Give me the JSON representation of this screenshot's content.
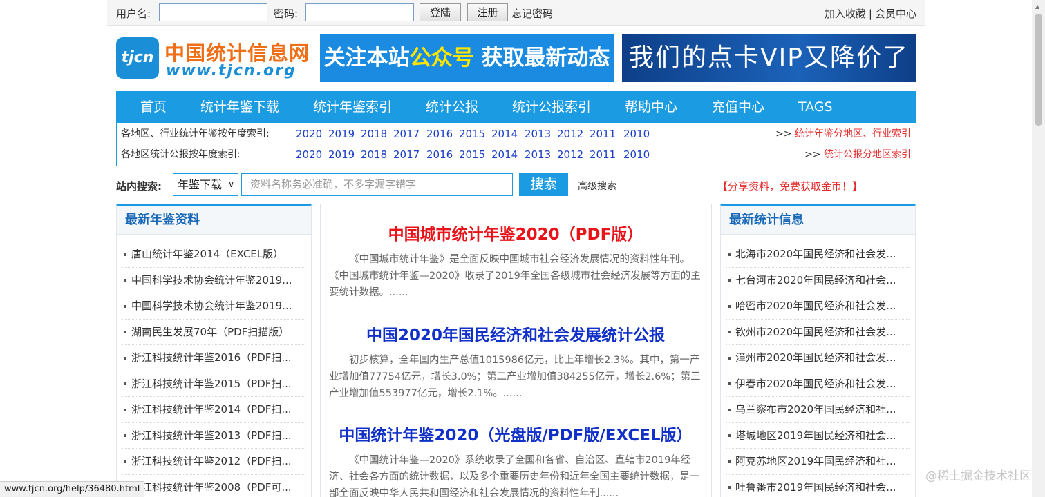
{
  "topbar": {
    "username_label": "用户名:",
    "password_label": "密码:",
    "login_button": "登陆",
    "register_button": "注册",
    "forgot_password": "忘记密码",
    "add_favorite": "加入收藏",
    "separator": "|",
    "member_center": "会员中心"
  },
  "header": {
    "logo_badge": "tjcn",
    "logo_cn": "中国统计信息网",
    "logo_en": "www.tjcn.org",
    "banner1_part1": "关注本站",
    "banner1_highlight": "公众号",
    "banner1_part2": " 获取最新动态",
    "banner2": "我们的点卡VIP又降价了"
  },
  "nav": {
    "items": [
      "首页",
      "统计年鉴下载",
      "统计年鉴索引",
      "统计公报",
      "统计公报索引",
      "帮助中心",
      "充值中心",
      "TAGS"
    ]
  },
  "year_index": {
    "row1_label": "各地区、行业统计年鉴按年度索引:",
    "row2_label": "各地区统计公报按年度索引:",
    "years": [
      "2020",
      "2019",
      "2018",
      "2017",
      "2016",
      "2015",
      "2014",
      "2013",
      "2012",
      "2011",
      "2010"
    ],
    "arrow": ">>",
    "row1_more": "统计年鉴分地区、行业索引",
    "row2_more": "统计公报分地区索引"
  },
  "search": {
    "label": "站内搜索:",
    "select_value": "年鉴下载",
    "placeholder": "资料名称务必准确，不多字漏字错字",
    "button": "搜索",
    "advanced": "高级搜索",
    "share_notice": "【分享资料，免费获取金币！】"
  },
  "left_panel": {
    "title": "最新年鉴资料",
    "items": [
      "唐山统计年鉴2014（EXCEL版）",
      "中国科学技术协会统计年鉴2019...",
      "中国科学技术协会统计年鉴2019...",
      "湖南民生发展70年（PDF扫描版）",
      "浙江科技统计年鉴2016（PDF扫...",
      "浙江科技统计年鉴2015（PDF扫...",
      "浙江科技统计年鉴2014（PDF扫...",
      "浙江科技统计年鉴2013（PDF扫...",
      "浙江科技统计年鉴2012（PDF扫...",
      "浙江科技统计年鉴2008（PDF可..."
    ]
  },
  "center": {
    "articles": [
      {
        "title": "中国城市统计年鉴2020（PDF版）",
        "color": "#e8141a",
        "summary": "《中国城市统计年鉴》是全面反映中国城市社会经济发展情况的资料性年刊。《中国城市统计年鉴—2020》收录了2019年全国各级城市社会经济发展等方面的主要统计数据。......"
      },
      {
        "title": "中国2020年国民经济和社会发展统计公报",
        "color": "#1030c8",
        "summary": "初步核算，全年国内生产总值1015986亿元，比上年增长2.3%。其中，第一产业增加值77754亿元，增长3.0%；第二产业增加值384255亿元，增长2.6%；第三产业增加值553977亿元，增长2.1%。......"
      },
      {
        "title": "中国统计年鉴2020（光盘版/PDF版/EXCEL版）",
        "color": "#1030c8",
        "summary": "《中国统计年鉴—2020》系统收录了全国和各省、自治区、直辖市2019年经济、社会各方面的统计数据，以及多个重要历史年份和近年全国主要统计数据，是一部全面反映中华人民共和国经济和社会发展情况的资料性年刊......"
      }
    ]
  },
  "right_panel": {
    "title": "最新统计信息",
    "items": [
      "北海市2020年国民经济和社会发...",
      "七台河市2020年国民经济和社会...",
      "哈密市2020年国民经济和社会发...",
      "钦州市2020年国民经济和社会发...",
      "漳州市2020年国民经济和社会发...",
      "伊春市2020年国民经济和社会发...",
      "乌兰察布市2020年国民经济和社...",
      "塔城地区2019年国民经济和社会...",
      "阿克苏地区2019年国民经济和社...",
      "吐鲁番市2019年国民经济和社会..."
    ]
  },
  "statusbar": {
    "url": "www.tjcn.org/help/36480.html"
  },
  "watermark": "@稀土掘金技术社区",
  "colors": {
    "accent": "#1a9be2",
    "link": "#1a3fc8",
    "alert": "#e53030",
    "logo_orange": "#ef6f18"
  }
}
